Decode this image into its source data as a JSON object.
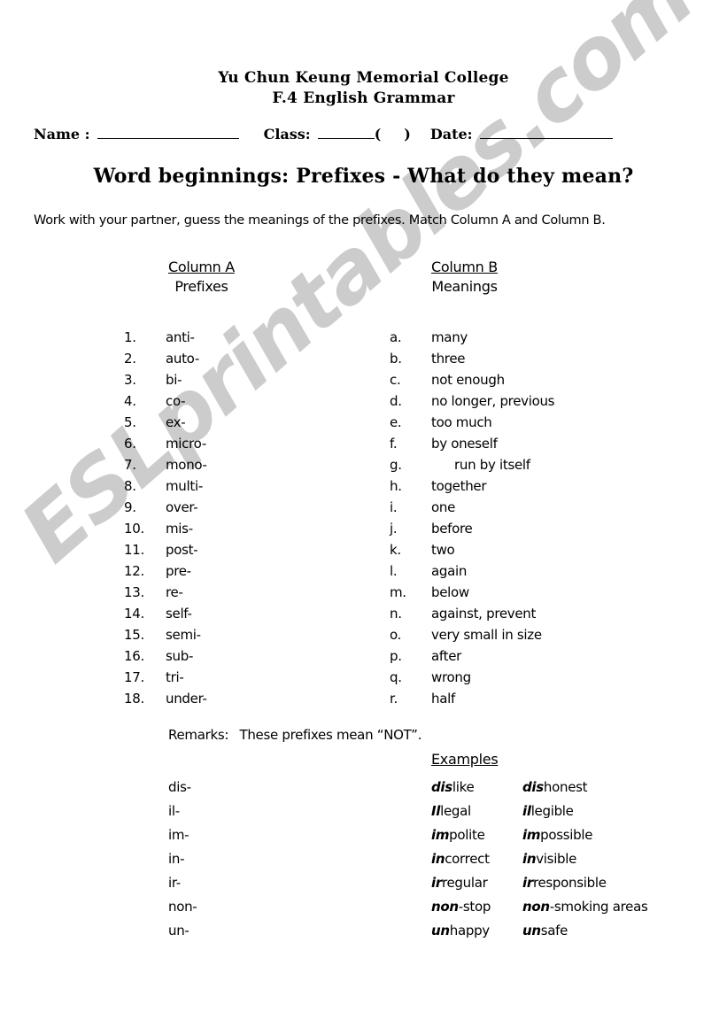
{
  "watermark": {
    "text": "ESLprintables.com",
    "color": "#cccccc"
  },
  "header": {
    "school": "Yu Chun Keung Memorial College",
    "course": "F.4 English Grammar",
    "name_label": "Name :",
    "class_label": "Class:",
    "paren_open": "(",
    "paren_close": ")",
    "date_label": "Date:"
  },
  "title": "Word beginnings: Prefixes - What do they mean?",
  "instruction": "Work with your partner, guess the meanings of the prefixes. Match Column A and Column B.",
  "columns": {
    "a": {
      "title": "Column A",
      "subtitle": "Prefixes"
    },
    "b": {
      "title": "Column B",
      "subtitle": "Meanings"
    }
  },
  "prefixes": [
    {
      "marker": "1.",
      "value": "anti-"
    },
    {
      "marker": "2.",
      "value": "auto-"
    },
    {
      "marker": "3.",
      "value": "bi-"
    },
    {
      "marker": "4.",
      "value": "co-"
    },
    {
      "marker": "5.",
      "value": "ex-"
    },
    {
      "marker": "6.",
      "value": "micro-"
    },
    {
      "marker": "7.",
      "value": "mono-"
    },
    {
      "marker": "8.",
      "value": "multi-"
    },
    {
      "marker": "9.",
      "value": "over-"
    },
    {
      "marker": "10.",
      "value": "mis-"
    },
    {
      "marker": "11.",
      "value": "post-"
    },
    {
      "marker": "12.",
      "value": "pre-"
    },
    {
      "marker": "13.",
      "value": "re-"
    },
    {
      "marker": "14.",
      "value": "self-"
    },
    {
      "marker": "15.",
      "value": "semi-"
    },
    {
      "marker": "16.",
      "value": "sub-"
    },
    {
      "marker": "17.",
      "value": "tri-"
    },
    {
      "marker": "18.",
      "value": "under-"
    }
  ],
  "meanings": [
    {
      "marker": "a.",
      "value": "many"
    },
    {
      "marker": "b.",
      "value": "three"
    },
    {
      "marker": "c.",
      "value": "not enough"
    },
    {
      "marker": "d.",
      "value": "no longer, previous"
    },
    {
      "marker": "e.",
      "value": "too much"
    },
    {
      "marker": "f.",
      "value": "by oneself"
    },
    {
      "marker": "g.",
      "value": "run by itself",
      "indented": true
    },
    {
      "marker": "h.",
      "value": "together"
    },
    {
      "marker": "i.",
      "value": "one"
    },
    {
      "marker": "j.",
      "value": "before"
    },
    {
      "marker": "k.",
      "value": "two"
    },
    {
      "marker": "l.",
      "value": "again"
    },
    {
      "marker": "m.",
      "value": "below"
    },
    {
      "marker": "n.",
      "value": "against, prevent"
    },
    {
      "marker": "o.",
      "value": "very small in size"
    },
    {
      "marker": "p.",
      "value": "after"
    },
    {
      "marker": "q.",
      "value": "wrong"
    },
    {
      "marker": "r.",
      "value": "half"
    }
  ],
  "remarks": {
    "label": "Remarks:",
    "text": "These prefixes mean “NOT”."
  },
  "examples_heading": "Examples",
  "examples": [
    {
      "prefix": "dis-",
      "w1_bold": "dis",
      "w1_rest": "like",
      "w2_bold": "dis",
      "w2_rest": "honest"
    },
    {
      "prefix": "il-",
      "w1_bold": "Il",
      "w1_rest": "legal",
      "w2_bold": "il",
      "w2_rest": "legible"
    },
    {
      "prefix": "im-",
      "w1_bold": "im",
      "w1_rest": "polite",
      "w2_bold": "im",
      "w2_rest": "possible"
    },
    {
      "prefix": "in-",
      "w1_bold": "in",
      "w1_rest": "correct",
      "w2_bold": "in",
      "w2_rest": "visible"
    },
    {
      "prefix": "ir-",
      "w1_bold": "ir",
      "w1_rest": "regular",
      "w2_bold": "ir",
      "w2_rest": "responsible"
    },
    {
      "prefix": "non-",
      "w1_bold": "non",
      "w1_rest": "-stop",
      "w2_bold": "non",
      "w2_rest": "-smoking areas"
    },
    {
      "prefix": "un-",
      "w1_bold": "un",
      "w1_rest": "happy",
      "w2_bold": "un",
      "w2_rest": "safe"
    }
  ]
}
